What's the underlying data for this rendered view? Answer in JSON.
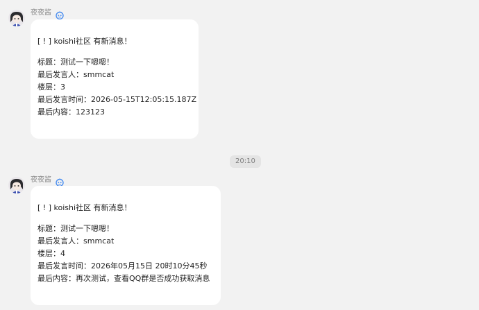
{
  "messages": [
    {
      "sender": "夜夜酱",
      "bot_icon": "bot-icon",
      "lines": [
        "[ ! ] koishi社区 有新消息！",
        "",
        "标题：测试一下嗯嗯！",
        "最后发言人：smmcat",
        "楼层：3",
        "最后发言时间：2026-05-15T12:05:15.187Z",
        "最后内容：123123"
      ]
    },
    {
      "sender": "夜夜酱",
      "bot_icon": "bot-icon",
      "lines": [
        "[ ! ] koishi社区 有新消息！",
        "",
        "标题：测试一下嗯嗯！",
        "最后发言人：smmcat",
        "楼层：4",
        "最后发言时间：2026年05月15日 20时10分45秒",
        "最后内容：再次测试，查看QQ群是否成功获取消息"
      ]
    }
  ],
  "divider_time": "20:10",
  "colors": {
    "background": "#f2f2f2",
    "bubble": "#ffffff",
    "bot_badge": "#4a8ef0"
  }
}
